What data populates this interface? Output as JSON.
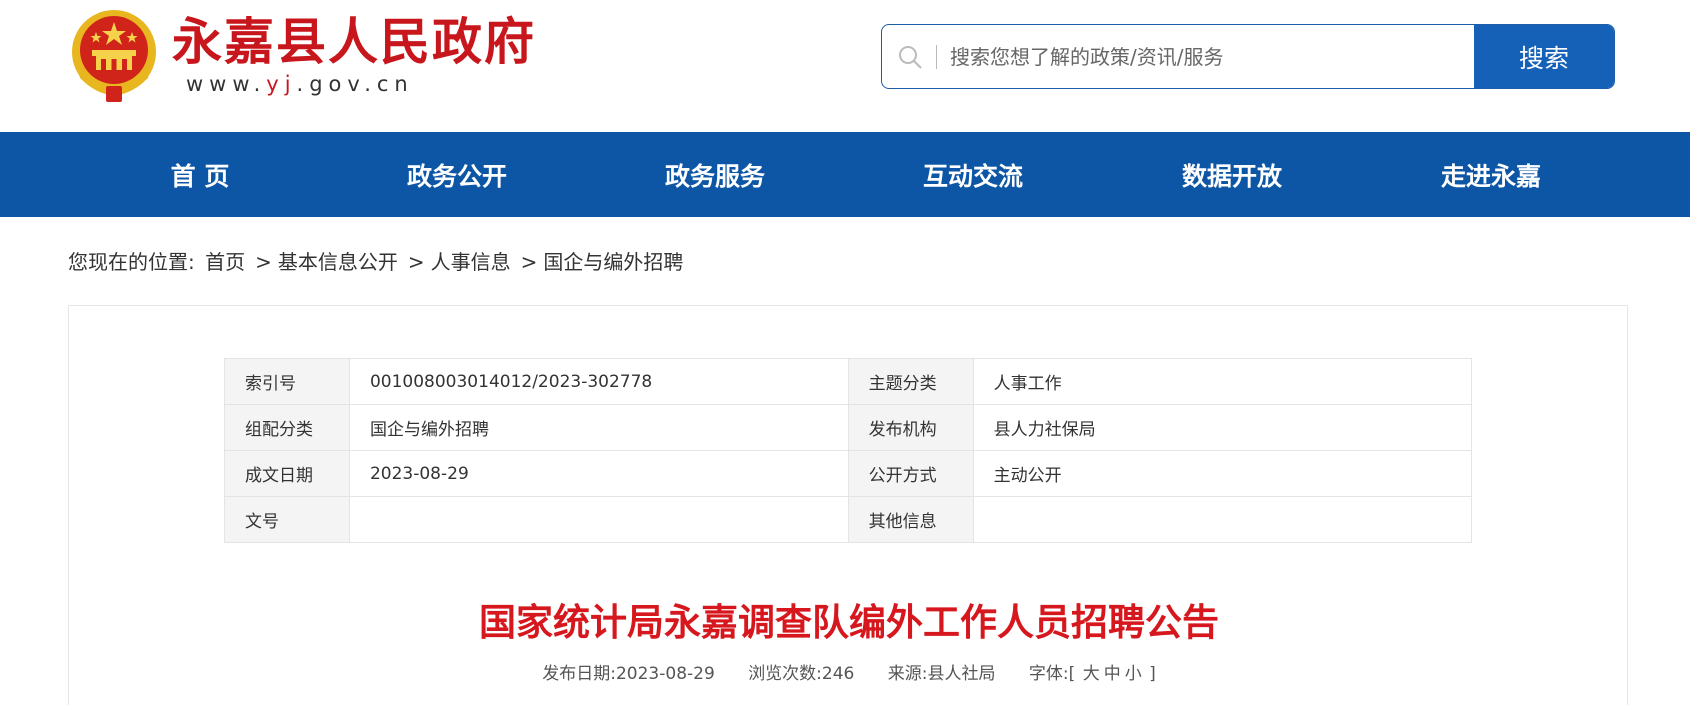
{
  "header": {
    "site_name": "永嘉县人民政府",
    "url_prefix": "www.",
    "url_highlight": "yj",
    "url_suffix": ".gov.cn",
    "search_placeholder": "搜索您想了解的政策/资讯/服务",
    "search_button": "搜索"
  },
  "nav": {
    "items": [
      "首 页",
      "政务公开",
      "政务服务",
      "互动交流",
      "数据开放",
      "走进永嘉"
    ]
  },
  "breadcrumb": {
    "label": "您现在的位置:",
    "items": [
      "首页",
      "基本信息公开",
      "人事信息",
      "国企与编外招聘"
    ],
    "separator": ">"
  },
  "meta_table": {
    "rows": [
      {
        "k1": "索引号",
        "v1": "001008003014012/2023-302778",
        "k2": "主题分类",
        "v2": "人事工作"
      },
      {
        "k1": "组配分类",
        "v1": "国企与编外招聘",
        "k2": "发布机构",
        "v2": "县人力社保局"
      },
      {
        "k1": "成文日期",
        "v1": "2023-08-29",
        "k2": "公开方式",
        "v2": "主动公开"
      },
      {
        "k1": "文号",
        "v1": "",
        "k2": "其他信息",
        "v2": ""
      }
    ]
  },
  "article": {
    "title": "国家统计局永嘉调查队编外工作人员招聘公告",
    "publish_date": "发布日期:2023-08-29",
    "views": "浏览次数:246",
    "source": "来源:县人社局",
    "font_label": "字体:",
    "font_open": "[",
    "font_large": "大",
    "font_medium": "中",
    "font_small": "小",
    "font_close": "]"
  },
  "colors": {
    "brand_red": "#c8161d",
    "nav_blue": "#0d56a6",
    "button_blue": "#1561b8",
    "title_red": "#d6171e"
  }
}
